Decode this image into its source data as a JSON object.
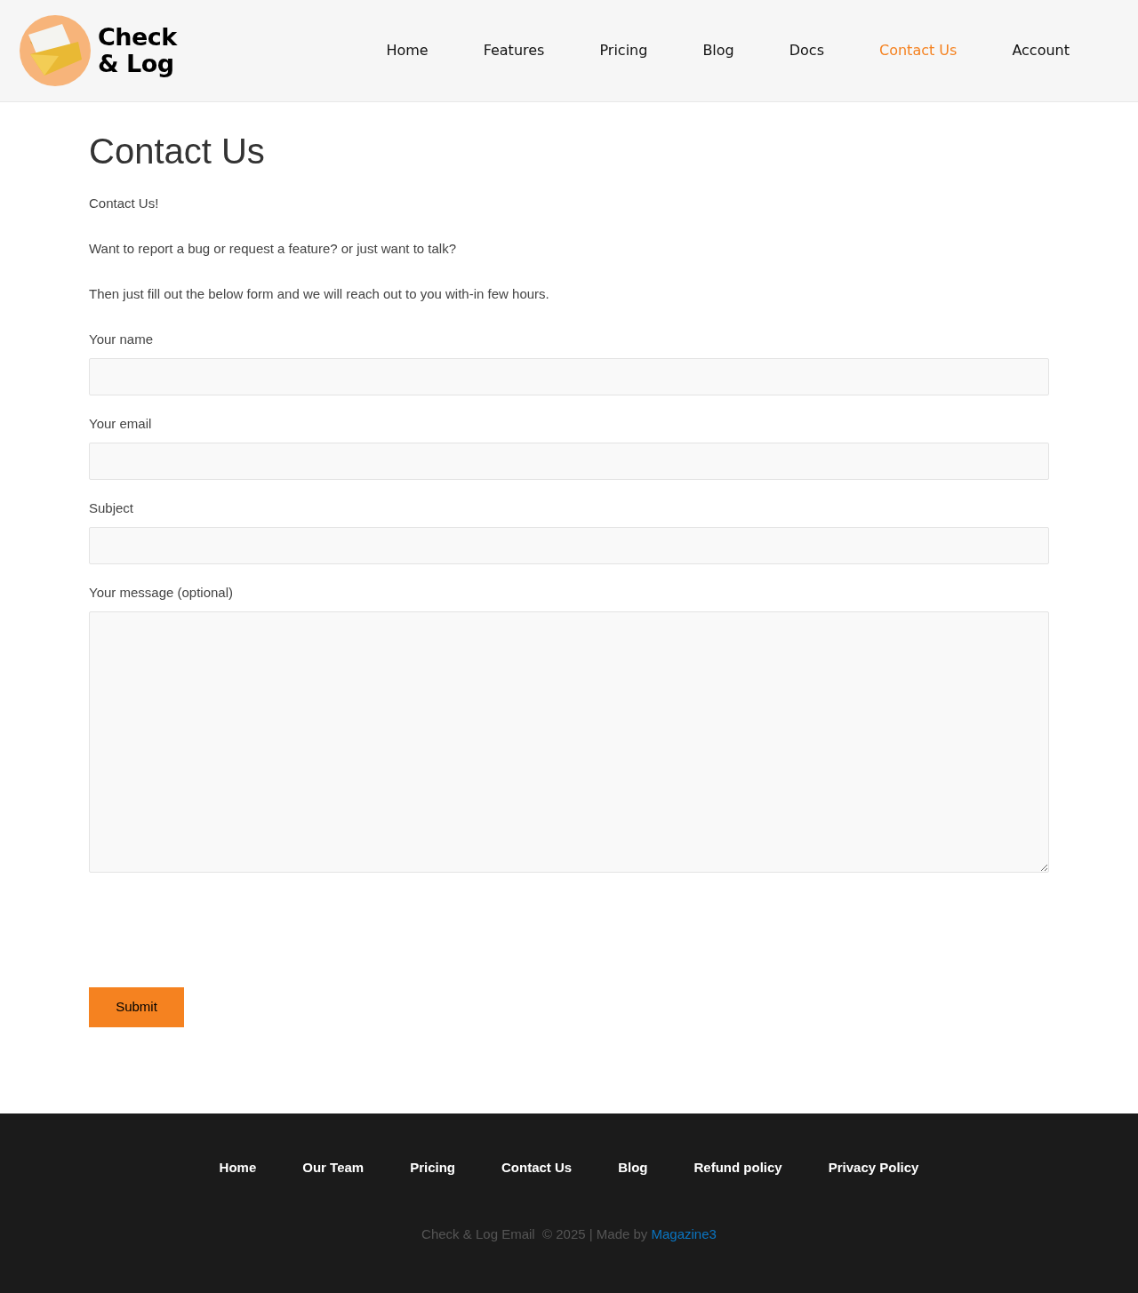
{
  "header": {
    "logo_text": [
      "Check",
      "& Log"
    ],
    "nav": [
      {
        "label": "Home",
        "selected": false
      },
      {
        "label": "Features",
        "selected": false
      },
      {
        "label": "Pricing",
        "selected": false
      },
      {
        "label": "Blog",
        "selected": false
      },
      {
        "label": "Docs",
        "selected": false
      },
      {
        "label": "Contact Us",
        "selected": true
      },
      {
        "label": "Account",
        "selected": false
      }
    ]
  },
  "page": {
    "title": "Contact Us",
    "paragraphs": [
      "Contact Us!",
      "Want to report a bug or request a feature? or just want to talk?",
      "Then just fill out the below form and we will reach out to you with-in few hours."
    ],
    "fields": [
      {
        "label": "Your name",
        "kind": "input"
      },
      {
        "label": "Your email",
        "kind": "input"
      },
      {
        "label": "Subject",
        "kind": "input"
      },
      {
        "label": "Your message (optional)",
        "kind": "textarea"
      }
    ],
    "submit": "Submit"
  },
  "footer": {
    "links": [
      "Home",
      "Our Team",
      "Pricing",
      "Contact Us",
      "Blog",
      "Refund policy",
      "Privacy Policy"
    ],
    "copyright": "Check & Log Email  © 2025 | Made by ",
    "credit_link": "Magazine3"
  }
}
